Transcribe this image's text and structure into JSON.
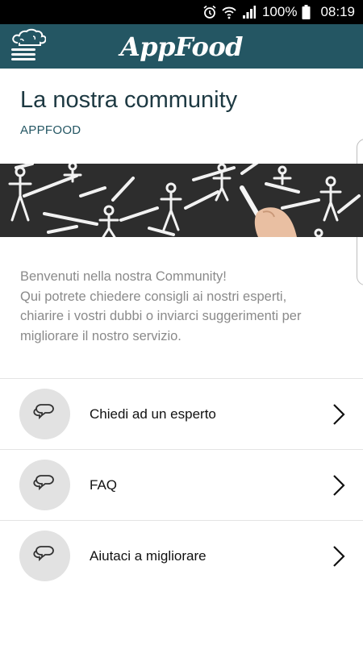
{
  "status_bar": {
    "battery": "100%",
    "time": "08:19",
    "icons": [
      "alarm-icon",
      "wifi-icon",
      "signal-icon",
      "battery-icon"
    ]
  },
  "app_bar": {
    "title": "AppFood",
    "menu_icon": "chef-hat-menu-icon",
    "background": "#245663"
  },
  "page": {
    "title": "La nostra community",
    "subtitle": "APPFOOD"
  },
  "hero": {
    "image": "chalkboard-people-network",
    "background": "#2f2f2f"
  },
  "intro": {
    "lines": [
      "Benvenuti nella nostra Community!",
      "Qui potrete chiedere consigli ai nostri esperti,",
      "chiarire i vostri dubbi o inviarci suggerimenti per",
      "migliorare il nostro servizio."
    ]
  },
  "menu": {
    "items": [
      {
        "label": "Chiedi ad un esperto",
        "icon": "chat-bubbles-icon"
      },
      {
        "label": "FAQ",
        "icon": "chat-bubbles-icon"
      },
      {
        "label": "Aiutaci a migliorare",
        "icon": "chat-bubbles-icon"
      }
    ]
  }
}
